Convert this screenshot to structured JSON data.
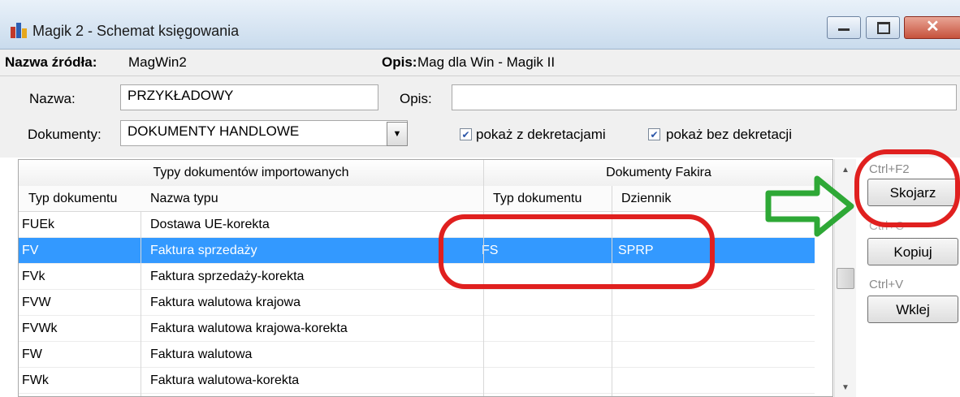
{
  "window": {
    "title": "Magik 2 - Schemat księgowania"
  },
  "source": {
    "name_label": "Nazwa źródła:",
    "name_value": "MagWin2",
    "desc_label": "Opis:",
    "desc_value": "Mag dla Win - Magik II"
  },
  "form": {
    "nazwa_label": "Nazwa:",
    "nazwa_value": "PRZYKŁADOWY",
    "opis_label": "Opis:",
    "opis_value": "",
    "dokumenty_label": "Dokumenty:",
    "dokumenty_value": "DOKUMENTY HANDLOWE",
    "check1_label": "pokaż z dekretacjami",
    "check2_label": "pokaż bez dekretacji"
  },
  "grid": {
    "group1": "Typy dokumentów importowanych",
    "group2": "Dokumenty Fakira",
    "columns": [
      "Typ dokumentu",
      "Nazwa typu",
      "Typ dokumentu",
      "Dziennik"
    ],
    "rows": [
      {
        "typ": "FUEk",
        "nazwa": "Dostawa UE-korekta",
        "fakir_typ": "",
        "dziennik": ""
      },
      {
        "typ": "FV",
        "nazwa": "Faktura sprzedaży",
        "fakir_typ": "FS",
        "dziennik": "SPRP"
      },
      {
        "typ": "FVk",
        "nazwa": "Faktura sprzedaży-korekta",
        "fakir_typ": "",
        "dziennik": ""
      },
      {
        "typ": "FVW",
        "nazwa": "Faktura walutowa krajowa",
        "fakir_typ": "",
        "dziennik": ""
      },
      {
        "typ": "FVWk",
        "nazwa": "Faktura walutowa krajowa-korekta",
        "fakir_typ": "",
        "dziennik": ""
      },
      {
        "typ": "FW",
        "nazwa": "Faktura walutowa",
        "fakir_typ": "",
        "dziennik": ""
      },
      {
        "typ": "FWk",
        "nazwa": "Faktura walutowa-korekta",
        "fakir_typ": "",
        "dziennik": ""
      }
    ]
  },
  "actions": {
    "skojarz_shortcut": "Ctrl+F2",
    "skojarz_label": "Skojarz",
    "kopiuj_shortcut": "Ctrl+C",
    "kopiuj_label": "Kopiuj",
    "wklej_shortcut": "Ctrl+V",
    "wklej_label": "Wklej"
  },
  "colors": {
    "selection": "#3399ff",
    "annotation_red": "#e0201f",
    "annotation_green": "#2ea836"
  }
}
